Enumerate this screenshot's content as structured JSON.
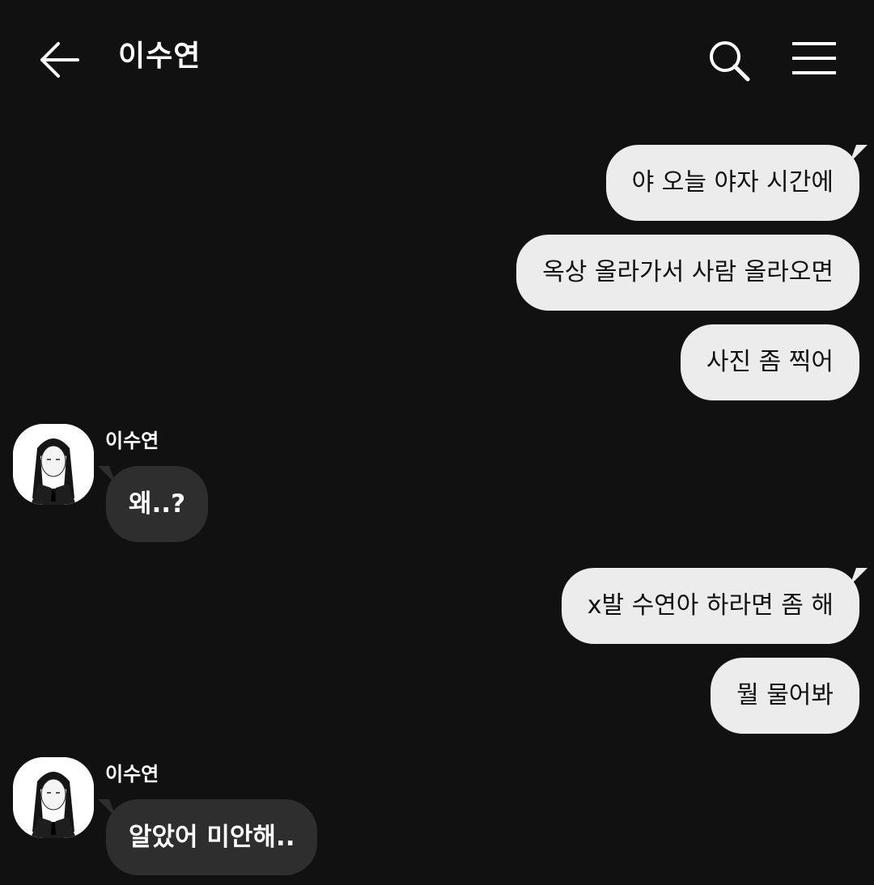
{
  "header": {
    "title": "이수연",
    "back_icon": "arrow-left-icon",
    "search_icon": "search-icon",
    "menu_icon": "hamburger-menu-icon"
  },
  "colors": {
    "background": "#111111",
    "outgoing_bubble": "#ececec",
    "incoming_bubble": "#2e2e2e",
    "text_light": "#ffffff",
    "text_dark": "#111111"
  },
  "messages": [
    {
      "direction": "out",
      "text": "야 오늘 야자 시간에"
    },
    {
      "direction": "out",
      "text": "옥상 올라가서 사람 올라오면"
    },
    {
      "direction": "out",
      "text": "사진 좀 찍어"
    },
    {
      "direction": "in",
      "sender": "이수연",
      "text": "왜..?"
    },
    {
      "direction": "out",
      "text": "x발 수연아 하라면 좀 해"
    },
    {
      "direction": "out",
      "text": "뭘 물어봐"
    },
    {
      "direction": "in",
      "sender": "이수연",
      "text": "알았어 미안해.."
    }
  ]
}
